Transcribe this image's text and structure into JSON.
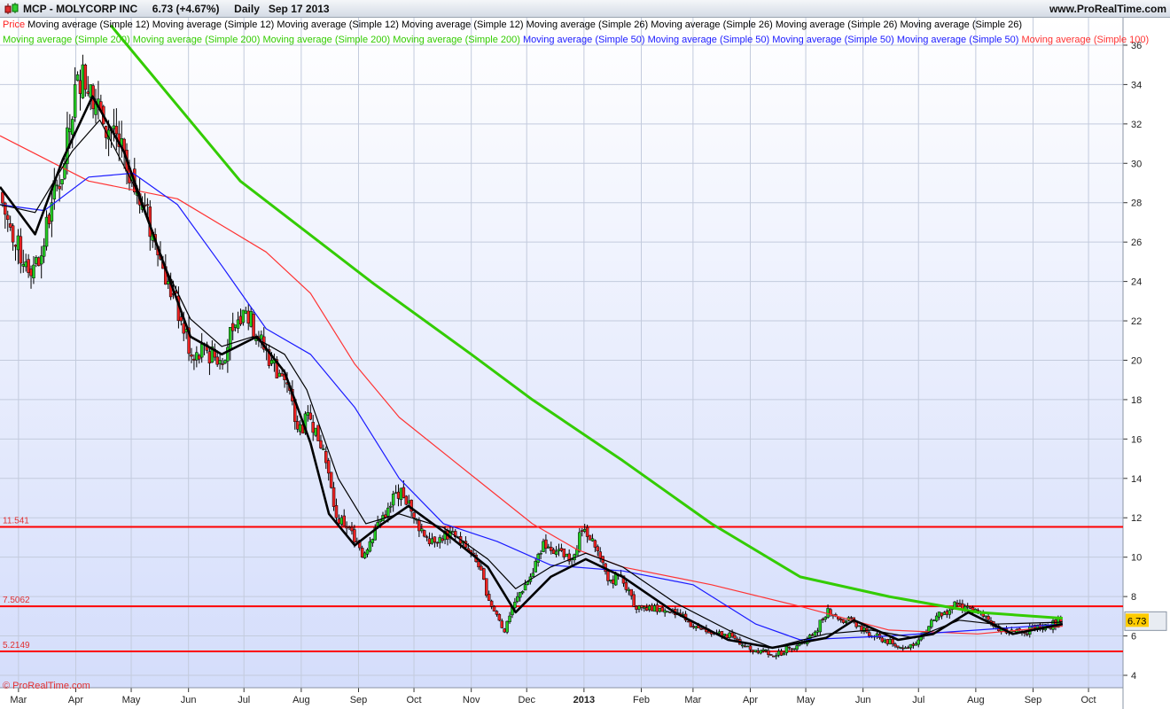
{
  "header": {
    "title": "MCP - MOLYCORP INC     6.73 (+4.67%)     Daily   Sep 17 2013",
    "site": "www.ProRealTime.com",
    "copyright": "© ProRealTime.com"
  },
  "legend": {
    "row1": [
      {
        "label": "Price",
        "color": "#ff2020"
      },
      {
        "label": "Moving average (Simple 12)",
        "color": "#000000"
      },
      {
        "label": "Moving average (Simple 12)",
        "color": "#000000"
      },
      {
        "label": "Moving average (Simple 12)",
        "color": "#000000"
      },
      {
        "label": "Moving average (Simple 12)",
        "color": "#000000"
      },
      {
        "label": "Moving average (Simple 26)",
        "color": "#000000"
      },
      {
        "label": "Moving average (Simple 26)",
        "color": "#000000"
      },
      {
        "label": "Moving average (Simple 26)",
        "color": "#000000"
      },
      {
        "label": "Moving average (Simple 26)",
        "color": "#000000"
      }
    ],
    "row2": [
      {
        "label": "Moving average (Simple 200)",
        "color": "#33cc00"
      },
      {
        "label": "Moving average (Simple 200)",
        "color": "#33cc00"
      },
      {
        "label": "Moving average (Simple 200)",
        "color": "#33cc00"
      },
      {
        "label": "Moving average (Simple 200)",
        "color": "#33cc00"
      },
      {
        "label": "Moving average (Simple 50)",
        "color": "#1a1aff"
      },
      {
        "label": "Moving average (Simple 50)",
        "color": "#1a1aff"
      },
      {
        "label": "Moving average (Simple 50)",
        "color": "#1a1aff"
      },
      {
        "label": "Moving average (Simple 50)",
        "color": "#1a1aff"
      },
      {
        "label": "Moving average (Simple 100)",
        "color": "#ff3333"
      }
    ]
  },
  "chart_data": {
    "type": "candlestick",
    "ylim": [
      3.5,
      37.2
    ],
    "y_ticks": [
      4,
      6,
      8,
      10,
      12,
      14,
      16,
      18,
      20,
      22,
      24,
      26,
      28,
      30,
      32,
      34,
      36
    ],
    "x_range": [
      "2012-02-20",
      "2013-10-25"
    ],
    "x_ticks": [
      {
        "label": "Mar",
        "date": "2012-03-01"
      },
      {
        "label": "Apr",
        "date": "2012-04-01"
      },
      {
        "label": "May",
        "date": "2012-05-01"
      },
      {
        "label": "Jun",
        "date": "2012-06-01"
      },
      {
        "label": "Jul",
        "date": "2012-07-01"
      },
      {
        "label": "Aug",
        "date": "2012-08-01"
      },
      {
        "label": "Sep",
        "date": "2012-09-01"
      },
      {
        "label": "Oct",
        "date": "2012-10-01"
      },
      {
        "label": "Nov",
        "date": "2012-11-01"
      },
      {
        "label": "Dec",
        "date": "2012-12-01"
      },
      {
        "label": "2013",
        "date": "2013-01-01",
        "bold": true
      },
      {
        "label": "Feb",
        "date": "2013-02-01"
      },
      {
        "label": "Mar",
        "date": "2013-03-01"
      },
      {
        "label": "Apr",
        "date": "2013-04-01"
      },
      {
        "label": "May",
        "date": "2013-05-01"
      },
      {
        "label": "Jun",
        "date": "2013-06-01"
      },
      {
        "label": "Jul",
        "date": "2013-07-01"
      },
      {
        "label": "Aug",
        "date": "2013-08-01"
      },
      {
        "label": "Sep",
        "date": "2013-09-01"
      },
      {
        "label": "Oct",
        "date": "2013-10-01"
      }
    ],
    "grid": true,
    "last_price": {
      "value": "6.73",
      "color": "#ffcc00"
    },
    "horizontal_lines": [
      {
        "label": "11.541",
        "value": 11.541,
        "color": "#ff0000"
      },
      {
        "label": "7.5062",
        "value": 7.5062,
        "color": "#ff0000"
      },
      {
        "label": "5.2149",
        "value": 5.2149,
        "color": "#ff0000"
      }
    ],
    "price_weekly_close": [
      [
        "2012-02-20",
        28.5
      ],
      [
        "2012-02-27",
        26
      ],
      [
        "2012-03-05",
        25
      ],
      [
        "2012-03-12",
        24.8
      ],
      [
        "2012-03-19",
        28
      ],
      [
        "2012-03-26",
        30
      ],
      [
        "2012-04-02",
        34.5
      ],
      [
        "2012-04-09",
        34
      ],
      [
        "2012-04-16",
        32
      ],
      [
        "2012-04-23",
        31.5
      ],
      [
        "2012-04-30",
        29
      ],
      [
        "2012-05-07",
        28
      ],
      [
        "2012-05-14",
        26
      ],
      [
        "2012-05-21",
        24
      ],
      [
        "2012-05-28",
        22
      ],
      [
        "2012-06-04",
        20
      ],
      [
        "2012-06-11",
        20.5
      ],
      [
        "2012-06-18",
        20
      ],
      [
        "2012-06-25",
        21.5
      ],
      [
        "2012-07-02",
        22.5
      ],
      [
        "2012-07-09",
        21
      ],
      [
        "2012-07-16",
        20
      ],
      [
        "2012-07-23",
        19
      ],
      [
        "2012-07-30",
        16.5
      ],
      [
        "2012-08-06",
        17
      ],
      [
        "2012-08-13",
        15.5
      ],
      [
        "2012-08-20",
        12
      ],
      [
        "2012-08-27",
        11.5
      ],
      [
        "2012-09-03",
        10
      ],
      [
        "2012-09-10",
        11.5
      ],
      [
        "2012-09-17",
        12.5
      ],
      [
        "2012-09-24",
        13.5
      ],
      [
        "2012-10-01",
        12
      ],
      [
        "2012-10-08",
        11
      ],
      [
        "2012-10-15",
        11
      ],
      [
        "2012-10-22",
        11.3
      ],
      [
        "2012-10-29",
        10.5
      ],
      [
        "2012-11-05",
        9.5
      ],
      [
        "2012-11-12",
        7.5
      ],
      [
        "2012-11-19",
        6.2
      ],
      [
        "2012-11-26",
        8
      ],
      [
        "2012-12-03",
        9
      ],
      [
        "2012-12-10",
        10.8
      ],
      [
        "2012-12-17",
        10.3
      ],
      [
        "2012-12-24",
        9.8
      ],
      [
        "2012-12-31",
        11.3
      ],
      [
        "2013-01-07",
        10.5
      ],
      [
        "2013-01-14",
        8.8
      ],
      [
        "2013-01-21",
        9.1
      ],
      [
        "2013-01-28",
        7.5
      ],
      [
        "2013-02-04",
        7.3
      ],
      [
        "2013-02-11",
        7.4
      ],
      [
        "2013-02-18",
        7.3
      ],
      [
        "2013-02-25",
        6.8
      ],
      [
        "2013-03-04",
        6.4
      ],
      [
        "2013-03-11",
        6.1
      ],
      [
        "2013-03-18",
        6.1
      ],
      [
        "2013-03-25",
        5.8
      ],
      [
        "2013-04-01",
        5.3
      ],
      [
        "2013-04-08",
        5.3
      ],
      [
        "2013-04-15",
        5.0
      ],
      [
        "2013-04-22",
        5.4
      ],
      [
        "2013-04-29",
        5.7
      ],
      [
        "2013-05-06",
        6.2
      ],
      [
        "2013-05-13",
        7.4
      ],
      [
        "2013-05-20",
        6.8
      ],
      [
        "2013-05-27",
        6.7
      ],
      [
        "2013-06-03",
        6.2
      ],
      [
        "2013-06-10",
        5.9
      ],
      [
        "2013-06-17",
        5.6
      ],
      [
        "2013-06-24",
        5.4
      ],
      [
        "2013-07-01",
        5.8
      ],
      [
        "2013-07-08",
        6.8
      ],
      [
        "2013-07-15",
        7.2
      ],
      [
        "2013-07-22",
        7.6
      ],
      [
        "2013-07-29",
        7.4
      ],
      [
        "2013-08-05",
        7.0
      ],
      [
        "2013-08-12",
        6.5
      ],
      [
        "2013-08-19",
        6.2
      ],
      [
        "2013-08-26",
        6.2
      ],
      [
        "2013-09-02",
        6.4
      ],
      [
        "2013-09-09",
        6.5
      ],
      [
        "2013-09-16",
        6.73
      ]
    ],
    "series": [
      {
        "name": "Moving average (Simple 200)",
        "color": "#33cc00",
        "width": 3,
        "points": [
          [
            "2012-04-20",
            37
          ],
          [
            "2012-06-29",
            29.1
          ],
          [
            "2012-09-09",
            23.9
          ],
          [
            "2012-11-01",
            20.3
          ],
          [
            "2012-12-04",
            18
          ],
          [
            "2013-01-22",
            14.9
          ],
          [
            "2013-03-11",
            11.7
          ],
          [
            "2013-04-28",
            9
          ],
          [
            "2013-06-15",
            8
          ],
          [
            "2013-08-02",
            7.2
          ],
          [
            "2013-09-17",
            6.9
          ]
        ]
      },
      {
        "name": "Moving average (Simple 100)",
        "color": "#ff3333",
        "width": 1.2,
        "points": [
          [
            "2012-02-20",
            31.4
          ],
          [
            "2012-04-08",
            29.1
          ],
          [
            "2012-05-26",
            28.2
          ],
          [
            "2012-07-13",
            25.5
          ],
          [
            "2012-08-06",
            23.4
          ],
          [
            "2012-08-30",
            19.8
          ],
          [
            "2012-09-23",
            17.1
          ],
          [
            "2012-11-10",
            13.5
          ],
          [
            "2012-12-04",
            11.7
          ],
          [
            "2012-12-28",
            10.4
          ],
          [
            "2013-01-22",
            9.5
          ],
          [
            "2013-03-11",
            8.6
          ],
          [
            "2013-04-28",
            7.5
          ],
          [
            "2013-06-15",
            6.3
          ],
          [
            "2013-08-02",
            6.1
          ],
          [
            "2013-09-17",
            6.5
          ]
        ]
      },
      {
        "name": "Moving average (Simple 50)",
        "color": "#1a1aff",
        "width": 1.2,
        "points": [
          [
            "2012-02-20",
            27.9
          ],
          [
            "2012-03-15",
            27.6
          ],
          [
            "2012-04-08",
            29.3
          ],
          [
            "2012-05-02",
            29.5
          ],
          [
            "2012-05-26",
            27.9
          ],
          [
            "2012-06-19",
            24.8
          ],
          [
            "2012-07-13",
            21.6
          ],
          [
            "2012-08-06",
            20.3
          ],
          [
            "2012-08-30",
            17.6
          ],
          [
            "2012-09-23",
            14
          ],
          [
            "2012-10-17",
            11.7
          ],
          [
            "2012-11-15",
            10.8
          ],
          [
            "2012-12-14",
            9.6
          ],
          [
            "2013-01-22",
            9.3
          ],
          [
            "2013-03-01",
            8.6
          ],
          [
            "2013-04-04",
            6.6
          ],
          [
            "2013-04-28",
            5.8
          ],
          [
            "2013-06-15",
            6
          ],
          [
            "2013-08-02",
            6.3
          ],
          [
            "2013-09-17",
            6.6
          ]
        ]
      },
      {
        "name": "Moving average (Simple 12)",
        "color": "#000000",
        "width": 1.2,
        "points": [
          [
            "2012-02-20",
            27.9
          ],
          [
            "2012-03-10",
            27.5
          ],
          [
            "2012-03-30",
            30.6
          ],
          [
            "2012-04-14",
            32.2
          ],
          [
            "2012-05-03",
            28.8
          ],
          [
            "2012-05-19",
            24.8
          ],
          [
            "2012-06-02",
            22.1
          ],
          [
            "2012-06-19",
            20.7
          ],
          [
            "2012-07-06",
            21.2
          ],
          [
            "2012-07-23",
            20.3
          ],
          [
            "2012-08-04",
            18.5
          ],
          [
            "2012-08-21",
            14
          ],
          [
            "2012-09-05",
            11.7
          ],
          [
            "2012-09-23",
            12.2
          ],
          [
            "2012-10-17",
            11.5
          ],
          [
            "2012-11-10",
            9.9
          ],
          [
            "2012-11-25",
            8.4
          ],
          [
            "2012-12-14",
            9.5
          ],
          [
            "2013-01-02",
            10.2
          ],
          [
            "2013-01-22",
            9.5
          ],
          [
            "2013-02-19",
            7.7
          ],
          [
            "2013-03-20",
            6.3
          ],
          [
            "2013-04-13",
            5.4
          ],
          [
            "2013-05-12",
            6.1
          ],
          [
            "2013-06-05",
            6.3
          ],
          [
            "2013-06-29",
            5.9
          ],
          [
            "2013-07-23",
            6.8
          ],
          [
            "2013-08-11",
            6.6
          ],
          [
            "2013-09-17",
            6.7
          ]
        ]
      },
      {
        "name": "Moving average (Simple 26)",
        "color": "#000000",
        "width": 2.6,
        "points": [
          [
            "2012-02-20",
            28.8
          ],
          [
            "2012-03-10",
            26.4
          ],
          [
            "2012-03-25",
            30.2
          ],
          [
            "2012-04-10",
            33.4
          ],
          [
            "2012-04-27",
            30.6
          ],
          [
            "2012-05-14",
            26.1
          ],
          [
            "2012-06-02",
            21.2
          ],
          [
            "2012-06-19",
            20.3
          ],
          [
            "2012-07-08",
            21.2
          ],
          [
            "2012-07-23",
            19.4
          ],
          [
            "2012-08-06",
            15.8
          ],
          [
            "2012-08-16",
            12.2
          ],
          [
            "2012-08-30",
            10.6
          ],
          [
            "2012-09-14",
            11.7
          ],
          [
            "2012-09-28",
            12.6
          ],
          [
            "2012-10-17",
            11.3
          ],
          [
            "2012-11-10",
            9.5
          ],
          [
            "2012-11-25",
            7.2
          ],
          [
            "2012-12-14",
            9
          ],
          [
            "2013-01-02",
            9.9
          ],
          [
            "2013-01-22",
            9
          ],
          [
            "2013-02-19",
            7.2
          ],
          [
            "2013-03-20",
            5.8
          ],
          [
            "2013-04-13",
            5.4
          ],
          [
            "2013-05-12",
            5.9
          ],
          [
            "2013-05-27",
            6.8
          ],
          [
            "2013-06-20",
            5.8
          ],
          [
            "2013-07-09",
            6.1
          ],
          [
            "2013-07-28",
            7.2
          ],
          [
            "2013-08-21",
            6.1
          ],
          [
            "2013-09-17",
            6.6
          ]
        ]
      }
    ]
  }
}
